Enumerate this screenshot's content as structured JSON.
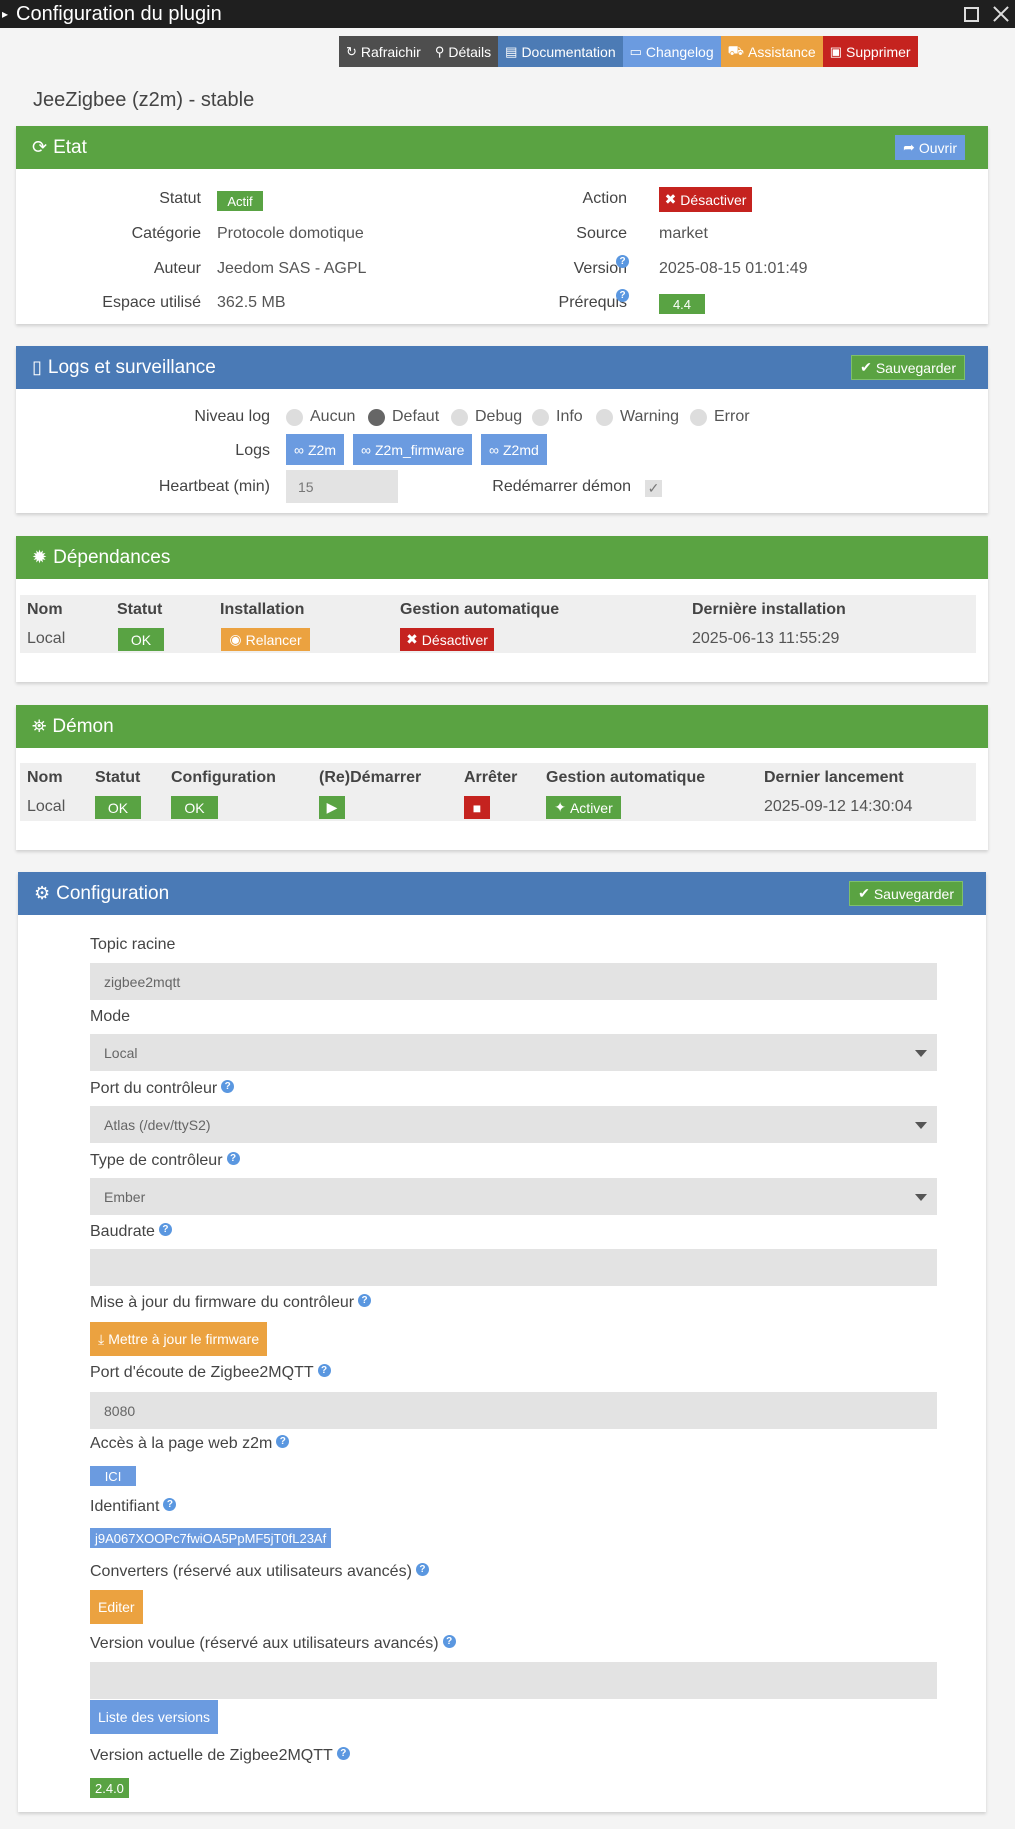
{
  "window": {
    "title": "Configuration du plugin"
  },
  "toolbar": {
    "refresh": "Rafraichir",
    "details": "Détails",
    "documentation": "Documentation",
    "changelog": "Changelog",
    "assistance": "Assistance",
    "delete": "Supprimer"
  },
  "plugin_name": "JeeZigbee (z2m) - stable",
  "etat": {
    "title": "Etat",
    "open_btn": "Ouvrir",
    "statut_label": "Statut",
    "statut_value": "Actif",
    "categorie_label": "Catégorie",
    "categorie_value": "Protocole domotique",
    "auteur_label": "Auteur",
    "auteur_value": "Jeedom SAS - AGPL",
    "espace_label": "Espace utilisé",
    "espace_value": "362.5 MB",
    "action_label": "Action",
    "action_btn": "Désactiver",
    "source_label": "Source",
    "source_value": "market",
    "version_label": "Version",
    "version_value": "2025-08-15 01:01:49",
    "prerequis_label": "Prérequis",
    "prerequis_value": "4.4"
  },
  "logs": {
    "title": "Logs et surveillance",
    "save_btn": "Sauvegarder",
    "niveau_label": "Niveau log",
    "levels": [
      "Aucun",
      "Defaut",
      "Debug",
      "Info",
      "Warning",
      "Error"
    ],
    "selected_level": "Defaut",
    "logs_label": "Logs",
    "log_files": [
      "Z2m",
      "Z2m_firmware",
      "Z2md"
    ],
    "heartbeat_label": "Heartbeat (min)",
    "heartbeat_value": "15",
    "restart_label": "Redémarrer démon",
    "restart_checked": true
  },
  "deps": {
    "title": "Dépendances",
    "headers": [
      "Nom",
      "Statut",
      "Installation",
      "Gestion automatique",
      "Dernière installation"
    ],
    "row": {
      "nom": "Local",
      "statut": "OK",
      "installation": "Relancer",
      "gestion": "Désactiver",
      "derniere": "2025-06-13 11:55:29"
    }
  },
  "daemon": {
    "title": "Démon",
    "headers": [
      "Nom",
      "Statut",
      "Configuration",
      "(Re)Démarrer",
      "Arrêter",
      "Gestion automatique",
      "Dernier lancement"
    ],
    "row": {
      "nom": "Local",
      "statut": "OK",
      "configuration": "OK",
      "gestion": "Activer",
      "dernier": "2025-09-12 14:30:04"
    }
  },
  "config": {
    "title": "Configuration",
    "save_btn": "Sauvegarder",
    "topic_label": "Topic racine",
    "topic_value": "zigbee2mqtt",
    "mode_label": "Mode",
    "mode_value": "Local",
    "port_label": "Port du contrôleur",
    "port_value": "Atlas (/dev/ttyS2)",
    "type_label": "Type de contrôleur",
    "type_value": "Ember",
    "baudrate_label": "Baudrate",
    "baudrate_value": "",
    "firmware_label": "Mise à jour du firmware du contrôleur",
    "firmware_btn": "Mettre à jour le firmware",
    "listen_port_label": "Port d'écoute de Zigbee2MQTT",
    "listen_port_value": "8080",
    "web_label": "Accès à la page web z2m",
    "web_btn": "ICI",
    "ident_label": "Identifiant",
    "ident_value": "j9A067XOOPc7fwiOA5PpMF5jT0fL23Af",
    "converters_label": "Converters (réservé aux utilisateurs avancés)",
    "converters_btn": "Editer",
    "wanted_version_label": "Version voulue (réservé aux utilisateurs avancés)",
    "wanted_version_value": "",
    "versions_btn": "Liste des versions",
    "current_version_label": "Version actuelle de Zigbee2MQTT",
    "current_version_value": "2.4.0"
  },
  "colors": {
    "green": "#5aa342",
    "blue": "#4a7ab6",
    "light_blue": "#6b9be0",
    "orange": "#eba240",
    "red": "#c5231f"
  }
}
